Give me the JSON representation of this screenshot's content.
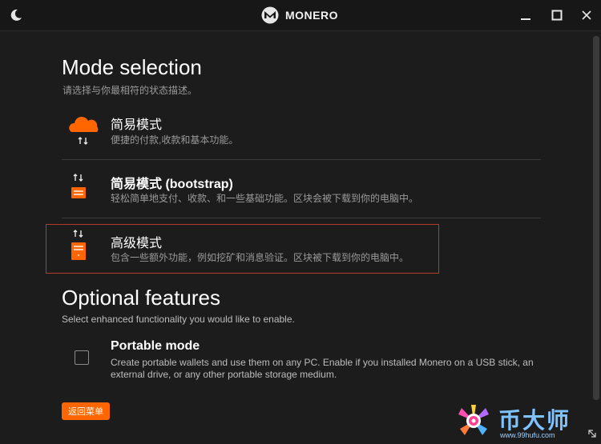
{
  "titlebar": {
    "brand": "MONERO"
  },
  "main": {
    "title": "Mode selection",
    "subtitle": "请选择与你最相符的状态描述。"
  },
  "modes": [
    {
      "title": "简易模式",
      "desc": "便捷的付款,收款和基本功能。"
    },
    {
      "title": "简易模式 (bootstrap)",
      "desc": "轻松简单地支付、收款、和一些基础功能。区块会被下载到你的电脑中。"
    },
    {
      "title": "高级模式",
      "desc": "包含一些额外功能，例如挖矿和消息验证。区块被下载到你的电脑中。",
      "selected": true
    }
  ],
  "optional": {
    "title": "Optional features",
    "subtitle": "Select enhanced functionality you would like to enable.",
    "portable": {
      "title": "Portable mode",
      "desc": "Create portable wallets and use them on any PC. Enable if you installed Monero on a USB stick, an external drive, or any other portable storage medium.",
      "checked": false
    }
  },
  "back_button": "返回菜单",
  "watermark": {
    "text": "币大师",
    "url": "www.99hufu.com"
  },
  "colors": {
    "accent": "#ff6600",
    "selection_border": "#b53a2c",
    "background": "#1c1c1c"
  }
}
